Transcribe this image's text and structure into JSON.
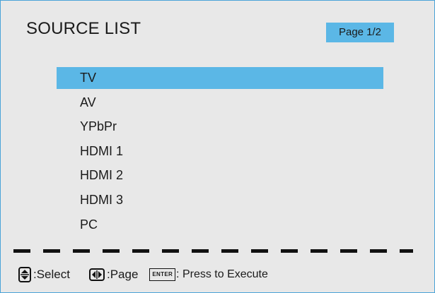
{
  "header": {
    "title": "SOURCE LIST",
    "page_indicator": "Page 1/2"
  },
  "sources": [
    {
      "label": "TV",
      "selected": true
    },
    {
      "label": "AV",
      "selected": false
    },
    {
      "label": "YPbPr",
      "selected": false
    },
    {
      "label": "HDMI 1",
      "selected": false
    },
    {
      "label": "HDMI 2",
      "selected": false
    },
    {
      "label": "HDMI 3",
      "selected": false
    },
    {
      "label": "PC",
      "selected": false
    }
  ],
  "help": {
    "select_icon": "up-down-arrows-icon",
    "select_label": ":Select",
    "page_icon": "left-right-arrows-icon",
    "page_label": ":Page",
    "enter_key_label": "ENTER",
    "enter_label": ": Press to Execute"
  },
  "colors": {
    "highlight": "#5bb7e6",
    "background": "#e8e8e8",
    "border": "#4aa3d8"
  }
}
